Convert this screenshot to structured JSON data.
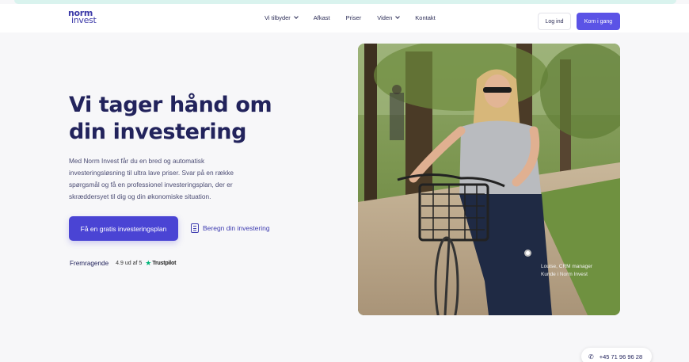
{
  "brand": {
    "line1": "norm",
    "line2": "invest"
  },
  "nav": {
    "items": [
      {
        "label": "Vi tilbyder",
        "dropdown": true
      },
      {
        "label": "Afkast",
        "dropdown": false
      },
      {
        "label": "Priser",
        "dropdown": false
      },
      {
        "label": "Viden",
        "dropdown": true
      },
      {
        "label": "Kontakt",
        "dropdown": false
      }
    ]
  },
  "header": {
    "login_label": "Log ind",
    "start_label": "Kom i gang"
  },
  "hero": {
    "title_line1": "Vi tager hånd om",
    "title_line2": "din investering",
    "lead": "Med Norm Invest får du en bred og automatisk investeringsløsning til ultra lave priser. Svar på en række spørgsmål og få en professionel investeringsplan, der er skræddersyet til dig og din økonomiske situation.",
    "primary_cta": "Få en gratis investeringsplan",
    "secondary_cta": "Beregn din investering",
    "rating_word": "Fremragende",
    "rating_score": "4.9 ud af 5",
    "rating_brand": "Trustpilot",
    "photo_caption_line1": "Louise, CRM manager",
    "photo_caption_line2": "Kunde i Norm Invest"
  },
  "contact": {
    "phone": "+45 71 96 96 28"
  },
  "colors": {
    "accent": "#5b53e6",
    "primary_button": "#4a44d4",
    "heading": "#22235c",
    "trustpilot": "#00b67a"
  },
  "icons": {
    "phone": "phone-icon",
    "calculator": "calculator-icon",
    "star": "star-icon",
    "chevron": "chevron-down-icon"
  }
}
